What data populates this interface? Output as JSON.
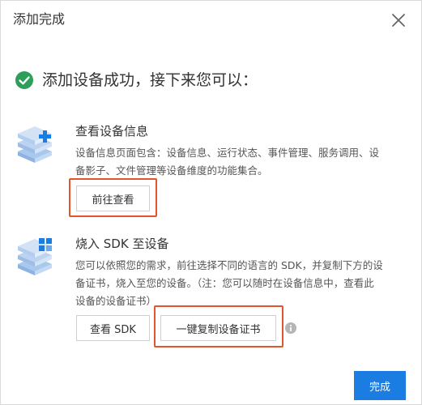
{
  "dialog": {
    "title": "添加完成",
    "close_icon": "close-icon"
  },
  "success": {
    "icon": "check-circle-icon",
    "color": "#2e9e5b",
    "message": "添加设备成功，接下来您可以："
  },
  "view_section": {
    "icon": "device-stack-plus-icon",
    "title": "查看设备信息",
    "desc_line1": "设备信息页面包含：设备信息、运行状态、事件管理、服务调用、设",
    "desc_line2": "备影子、文件管理等设备维度的功能集合。",
    "go_view_label": "前往查看"
  },
  "sdk_section": {
    "icon": "device-stack-grid-icon",
    "title": "烧入 SDK 至设备",
    "desc_line1": "您可以依照您的需求，前往选择不同的语言的 SDK，并复制下方的设",
    "desc_line2": "备证书，烧入至您的设备。（注：您可以随时在设备信息中，查看此",
    "desc_line3": "设备的设备证书）",
    "view_sdk_label": "查看 SDK",
    "copy_cert_label": "一键复制设备证书",
    "info_icon": "info-icon"
  },
  "footer": {
    "done_label": "完成",
    "primary_color": "#1b7de1"
  },
  "highlight_color": "#e3562b"
}
